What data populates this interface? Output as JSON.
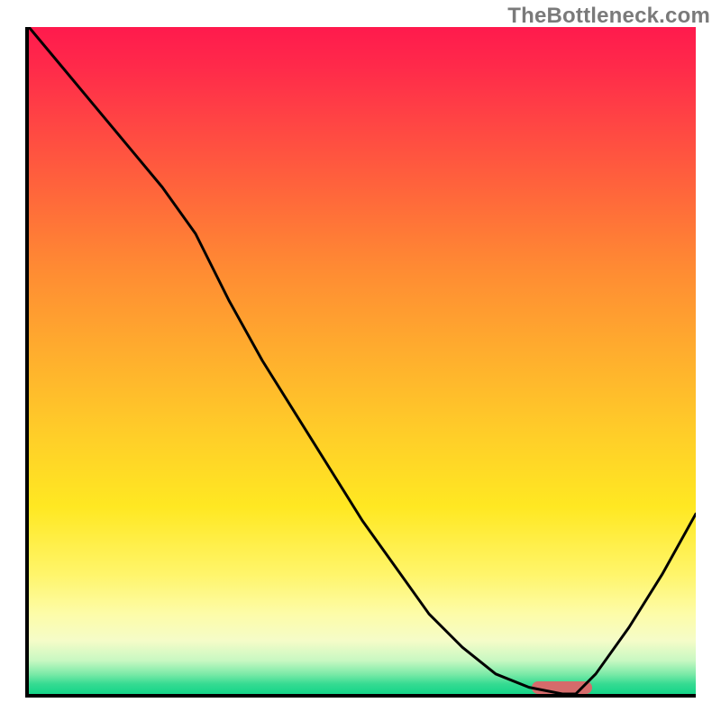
{
  "watermark": "TheBottleneck.com",
  "colors": {
    "axis": "#000000",
    "curve": "#000000",
    "marker": "#d56b6b",
    "watermark": "#7a7a7a"
  },
  "chart_data": {
    "type": "line",
    "title": "",
    "xlabel": "",
    "ylabel": "",
    "xlim": [
      0,
      100
    ],
    "ylim": [
      0,
      100
    ],
    "grid": false,
    "legend": false,
    "series": [
      {
        "name": "curve",
        "x": [
          0,
          5,
          10,
          15,
          20,
          25,
          30,
          35,
          40,
          45,
          50,
          55,
          60,
          65,
          70,
          75,
          80,
          82,
          85,
          90,
          95,
          100
        ],
        "y": [
          100,
          94,
          88,
          82,
          76,
          69,
          59,
          50,
          42,
          34,
          26,
          19,
          12,
          7,
          3,
          1,
          0,
          0,
          3,
          10,
          18,
          27
        ]
      }
    ],
    "annotations": [
      {
        "name": "optimal-marker",
        "type": "rounded-bar",
        "x_start": 75,
        "x_end": 84,
        "y": 1.5,
        "color": "#d56b6b"
      }
    ],
    "gradient_stops": [
      {
        "pct": 0,
        "color": "#ff1a4d"
      },
      {
        "pct": 14,
        "color": "#ff4444"
      },
      {
        "pct": 36,
        "color": "#ff8a33"
      },
      {
        "pct": 62,
        "color": "#ffd028"
      },
      {
        "pct": 82,
        "color": "#fff56a"
      },
      {
        "pct": 95,
        "color": "#c8f8c2"
      },
      {
        "pct": 100,
        "color": "#14d488"
      }
    ]
  }
}
